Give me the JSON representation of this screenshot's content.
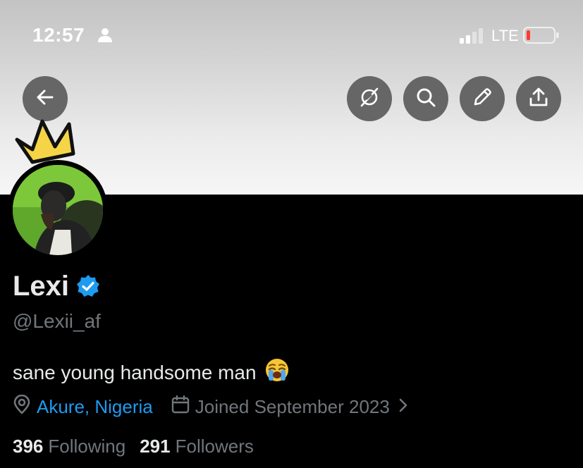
{
  "status_bar": {
    "time": "12:57",
    "network": "LTE",
    "battery_color": "#ff3b30"
  },
  "toolbar": {
    "back_icon": "arrow-left-icon",
    "actions": [
      "grok-icon",
      "search-icon",
      "edit-icon",
      "share-icon"
    ]
  },
  "profile": {
    "name": "Lexi",
    "verified": true,
    "handle": "@Lexii_af",
    "bio": "sane young handsome man",
    "bio_emoji": "😭",
    "location": "Akure, Nigeria",
    "joined": "Joined September 2023",
    "following_count": "396",
    "following_label": "Following",
    "followers_count": "291",
    "followers_label": "Followers"
  },
  "colors": {
    "accent": "#1d9bf0",
    "muted": "#71767b",
    "text": "#e7e9ea",
    "background": "#000000"
  }
}
